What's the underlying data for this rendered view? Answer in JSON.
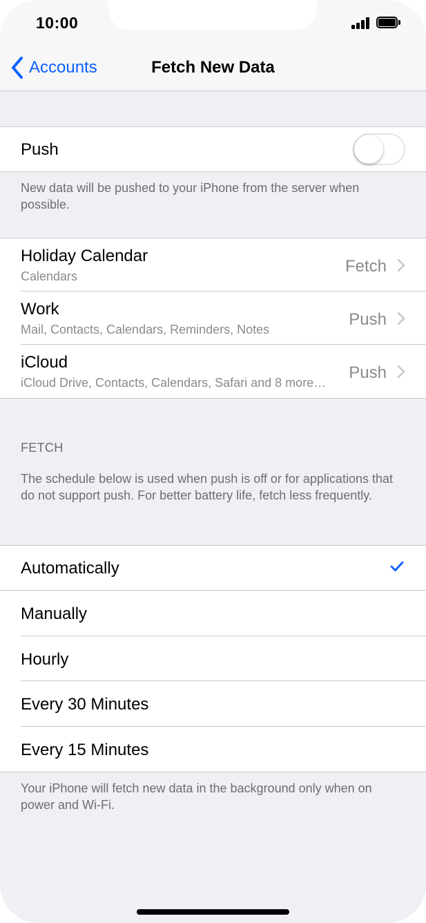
{
  "status_bar": {
    "time": "10:00",
    "signal_icon": "cellular-signal-icon",
    "battery_icon": "battery-full-icon"
  },
  "nav": {
    "back_label": "Accounts",
    "back_icon": "chevron-left-icon",
    "title": "Fetch New Data",
    "accent_color": "#0a60ff"
  },
  "push": {
    "label": "Push",
    "toggle_on": false,
    "footer": "New data will be pushed to your iPhone from the server when possible."
  },
  "accounts": [
    {
      "title": "Holiday Calendar",
      "subtitle": "Calendars",
      "value": "Fetch"
    },
    {
      "title": "Work",
      "subtitle": "Mail, Contacts, Calendars, Reminders, Notes",
      "value": "Push"
    },
    {
      "title": "iCloud",
      "subtitle": "iCloud Drive, Contacts, Calendars, Safari and 8 more…",
      "value": "Push"
    }
  ],
  "fetch": {
    "header": "FETCH",
    "description": "The schedule below is used when push is off or for applications that do not support push. For better battery life, fetch less frequently.",
    "options": [
      {
        "label": "Automatically",
        "selected": true
      },
      {
        "label": "Manually",
        "selected": false
      },
      {
        "label": "Hourly",
        "selected": false
      },
      {
        "label": "Every 30 Minutes",
        "selected": false
      },
      {
        "label": "Every 15 Minutes",
        "selected": false
      }
    ],
    "footer": "Your iPhone will fetch new data in the background only when on power and Wi-Fi.",
    "check_color": "#0a60ff"
  }
}
